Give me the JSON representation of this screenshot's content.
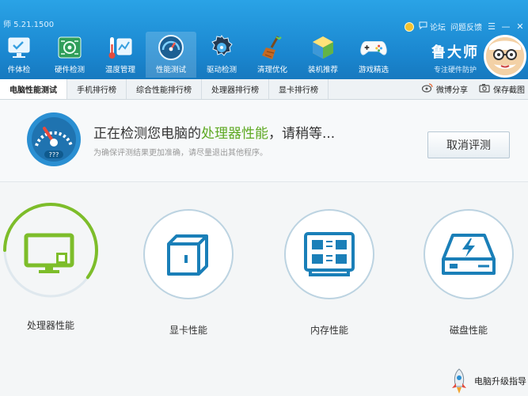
{
  "app": {
    "version": "师 5.21.1500"
  },
  "top_links": {
    "forum": "论坛",
    "feedback": "问题反馈"
  },
  "window": {
    "menu_glyph": "☰",
    "minimize_glyph": "—",
    "close_glyph": "✕"
  },
  "toolbar": [
    {
      "label": "件体检",
      "icon": "monitor-check-icon"
    },
    {
      "label": "硬件检测",
      "icon": "circuit-board-icon"
    },
    {
      "label": "温度管理",
      "icon": "thermometer-icon"
    },
    {
      "label": "性能测试",
      "icon": "speed-gauge-icon",
      "active": true
    },
    {
      "label": "驱动检测",
      "icon": "gear-disc-icon"
    },
    {
      "label": "清理优化",
      "icon": "broom-icon"
    },
    {
      "label": "装机推荐",
      "icon": "cube-icon"
    },
    {
      "label": "游戏精选",
      "icon": "gamepad-icon"
    }
  ],
  "brand": {
    "name": "鲁大师",
    "slogan": "专注硬件防护"
  },
  "tabs": [
    {
      "label": "电脑性能测试",
      "active": true
    },
    {
      "label": "手机排行榜"
    },
    {
      "label": "综合性能排行榜"
    },
    {
      "label": "处理器排行榜"
    },
    {
      "label": "显卡排行榜"
    }
  ],
  "tab_actions": {
    "share": "微博分享",
    "save": "保存截图"
  },
  "status": {
    "title_prefix": "正在检测您电脑的",
    "title_highlight": "处理器性能",
    "title_suffix": "，请稍等...",
    "subtitle": "为确保评测结果更加准确，请尽量退出其他程序。",
    "gauge_label": "???",
    "cancel_button": "取消评测"
  },
  "tests": [
    {
      "label": "处理器性能",
      "icon": "cpu-monitor-icon",
      "progress": 0.6,
      "accent": "#7dbd2a"
    },
    {
      "label": "显卡性能",
      "icon": "gpu-cube-icon"
    },
    {
      "label": "内存性能",
      "icon": "memory-chip-icon"
    },
    {
      "label": "磁盘性能",
      "icon": "disk-drive-icon"
    }
  ],
  "upgrade": {
    "label": "电脑升级指导"
  },
  "colors": {
    "accent_green": "#7dbd2a",
    "accent_blue": "#1a7fb8",
    "header_blue": "#1a86cf"
  }
}
